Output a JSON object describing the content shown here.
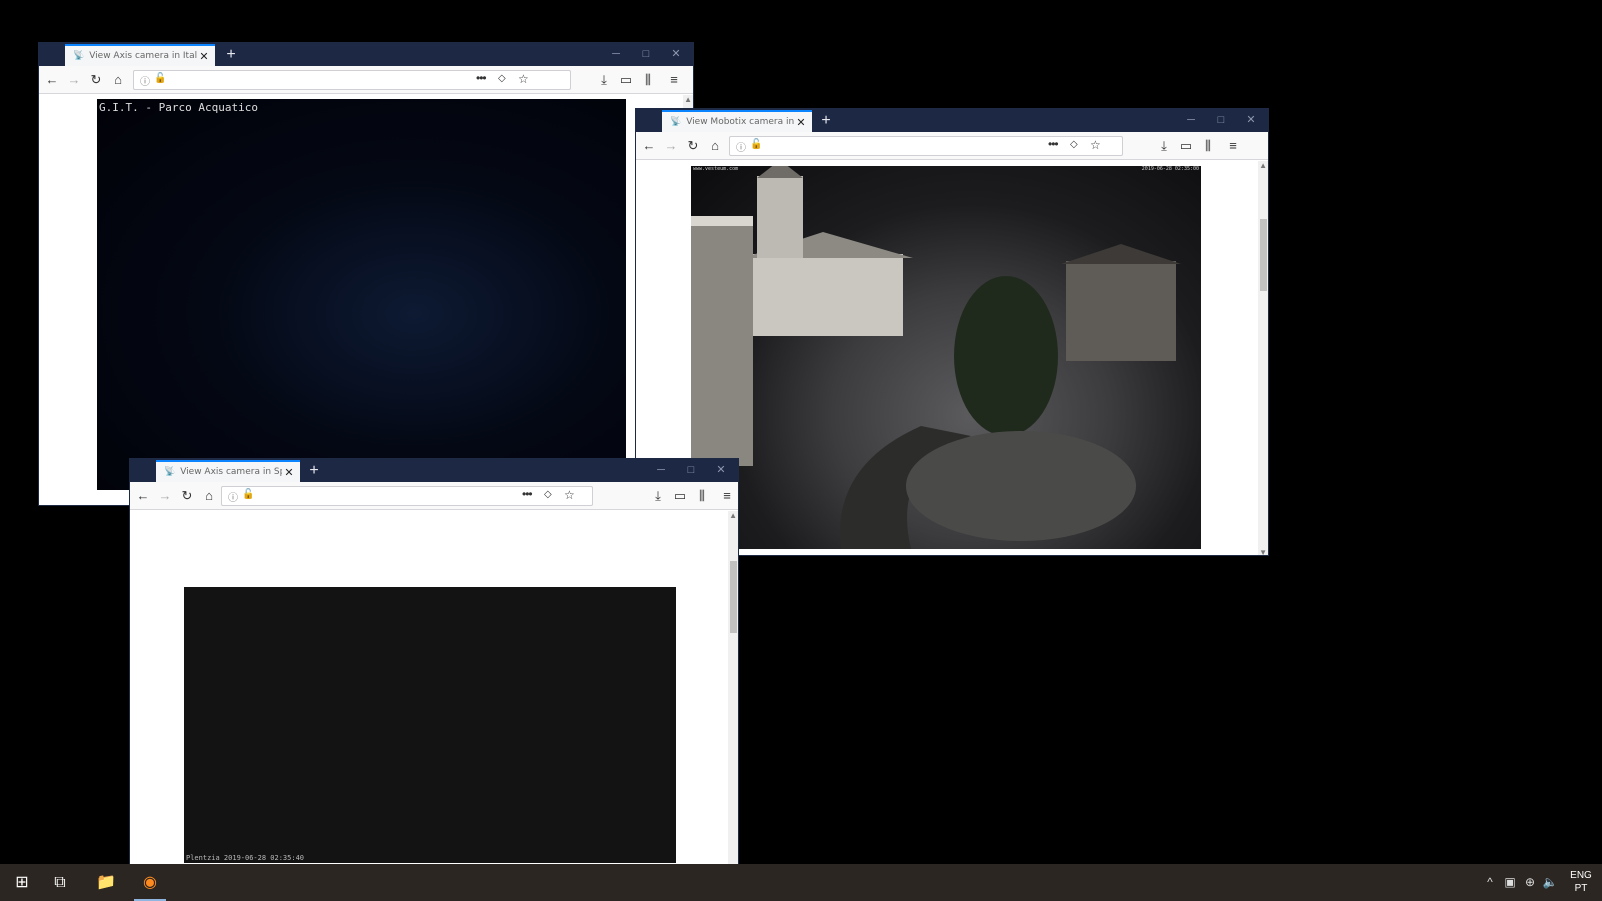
{
  "windows": [
    {
      "id": "italy",
      "tab_title": "View Axis camera in Italy, Pado",
      "camera_caption": "G.I.T. - Parco Acquatico"
    },
    {
      "id": "austria",
      "tab_title": "View Mobotix camera in Austri",
      "camera_stamp_left": "www.vesteum.com",
      "camera_stamp_right": "2019-06-28 02:35:00"
    },
    {
      "id": "spain",
      "tab_title": "View Axis camera in Spain, Da",
      "camera_stamp": "Plentzia 2019-06-28 02:35:40"
    }
  ],
  "browser": {
    "new_tab": "+",
    "back": "←",
    "forward": "→",
    "reload": "↻",
    "home": "⌂",
    "info": "ⓘ",
    "lock": "🔓",
    "page_actions": "•••",
    "pocket": "◇",
    "bookmark": "☆",
    "downloads": "⤓",
    "sidebar": "▭",
    "library": "⫼",
    "menu": "≡",
    "minimize": "─",
    "maximize": "□",
    "close": "✕",
    "tab_close": "✕",
    "favicon": "📡"
  },
  "taskbar": {
    "start": "⊞",
    "task_view": "⧉",
    "explorer": "📁",
    "firefox": "◉",
    "tray_up": "^",
    "network": "▣",
    "globe": "⊕",
    "volume": "🔈",
    "lang_line1": "ENG",
    "lang_line2": "PT"
  },
  "colors": {
    "tab_accent": "#0a84ff",
    "titlebar": "#1d2845",
    "taskbar": "#2b2622"
  }
}
